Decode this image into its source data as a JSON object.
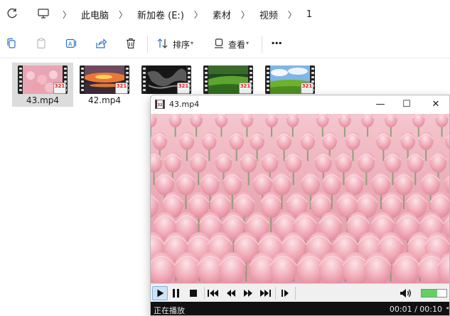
{
  "breadcrumbs": [
    "此电脑",
    "新加卷 (E:)",
    "素材",
    "视频",
    "1"
  ],
  "toolbar": {
    "sort_label": "排序",
    "view_label": "查看",
    "more_label": "···"
  },
  "files": [
    {
      "name": "43.mp4",
      "selected": true,
      "thumb": "tulips"
    },
    {
      "name": "42.mp4",
      "selected": false,
      "thumb": "sunset"
    },
    {
      "name": "",
      "selected": false,
      "thumb": "dark"
    },
    {
      "name": "",
      "selected": false,
      "thumb": "green-hill"
    },
    {
      "name": "",
      "selected": false,
      "thumb": "field-sky"
    }
  ],
  "badge_text": "321",
  "player": {
    "title": "43.mp4",
    "minimize": "—",
    "maximize": "☐",
    "close": "✕",
    "status_text": "正在播放",
    "time_text": "00:01 / 00:10",
    "volume_level": 0.62,
    "play_active": true
  },
  "colors": {
    "selection": "#dcdcdc",
    "status_bar": "#111111",
    "volume_fill": "#62d162"
  }
}
